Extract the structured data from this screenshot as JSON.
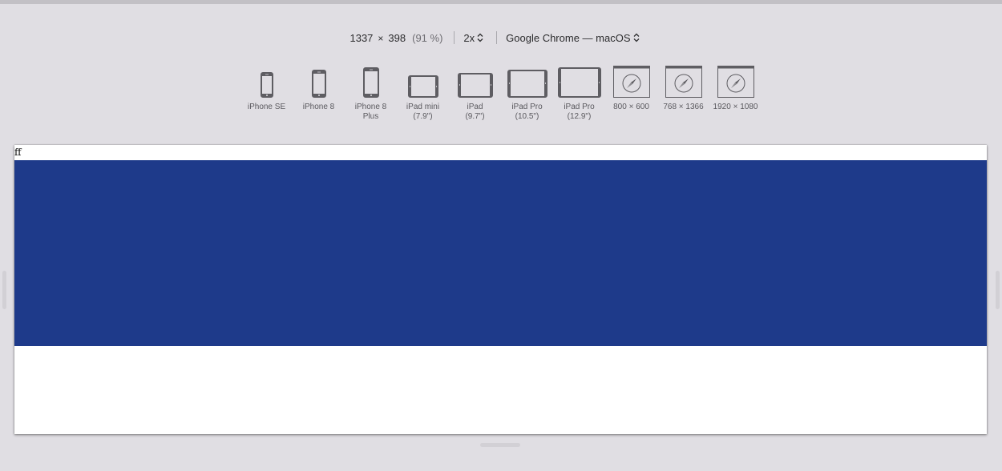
{
  "toolbar": {
    "width": "1337",
    "times": "×",
    "height": "398",
    "zoom_percent": "(91 %)",
    "pixel_ratio": "2x",
    "browser_os": "Google Chrome — macOS"
  },
  "devices": [
    {
      "label": "iPhone SE",
      "icon": "phone-icon"
    },
    {
      "label": "iPhone 8",
      "icon": "phone-icon"
    },
    {
      "label": "iPhone 8\nPlus",
      "icon": "phone-icon"
    },
    {
      "label": "iPad mini\n(7.9\")",
      "icon": "tablet-icon"
    },
    {
      "label": "iPad\n(9.7\")",
      "icon": "tablet-icon"
    },
    {
      "label": "iPad Pro\n(10.5\")",
      "icon": "tablet-icon"
    },
    {
      "label": "iPad Pro\n(12.9\")",
      "icon": "tablet-icon"
    },
    {
      "label": "800 × 600",
      "icon": "safari-window-icon"
    },
    {
      "label": "768 × 1366",
      "icon": "safari-window-icon"
    },
    {
      "label": "1920 × 1080",
      "icon": "safari-window-icon"
    }
  ],
  "preview": {
    "text": "ff",
    "banner_color": "#1e3a8a",
    "background_color": "#ffffff"
  }
}
